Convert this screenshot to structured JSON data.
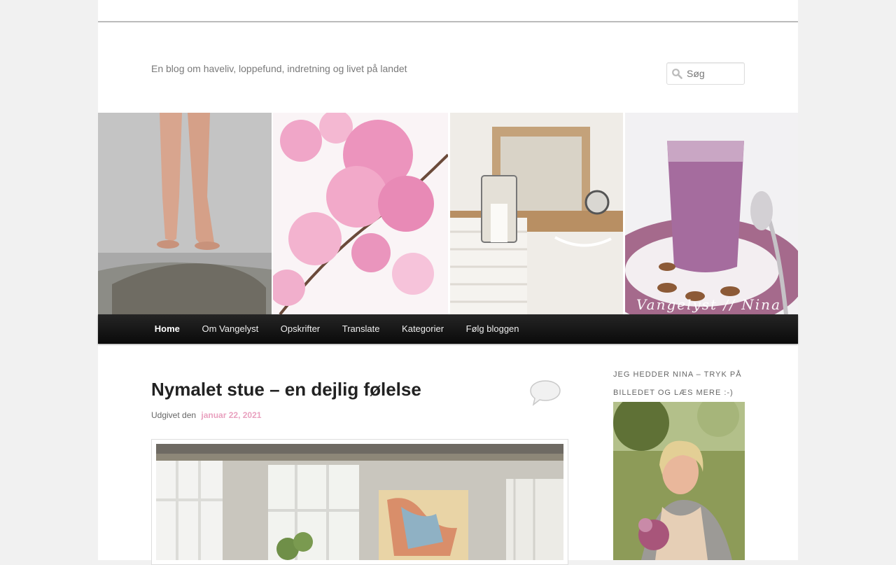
{
  "header": {
    "tagline": "En blog om haveliv, loppefund, indretning og livet på landet",
    "search": {
      "placeholder": "Søg",
      "icon": "search-icon"
    }
  },
  "banner": {
    "signature": "Vangelyst // Nina"
  },
  "nav": {
    "items": [
      {
        "label": "Home",
        "current": true
      },
      {
        "label": "Om Vangelyst"
      },
      {
        "label": "Opskrifter"
      },
      {
        "label": "Translate"
      },
      {
        "label": "Kategorier"
      },
      {
        "label": "Følg bloggen"
      }
    ]
  },
  "post": {
    "title": "Nymalet stue – en dejlig følelse",
    "meta_prefix": "Udgivet den",
    "date": "januar 22, 2021",
    "comment_icon": "comment-bubble-icon"
  },
  "sidebar": {
    "widget_title": "Jeg hedder Nina – tryk på billedet og læs mere :-)"
  },
  "colors": {
    "nav_background": "#111111",
    "date_link": "#e9a1bf",
    "tagline": "#7a7a7a"
  }
}
